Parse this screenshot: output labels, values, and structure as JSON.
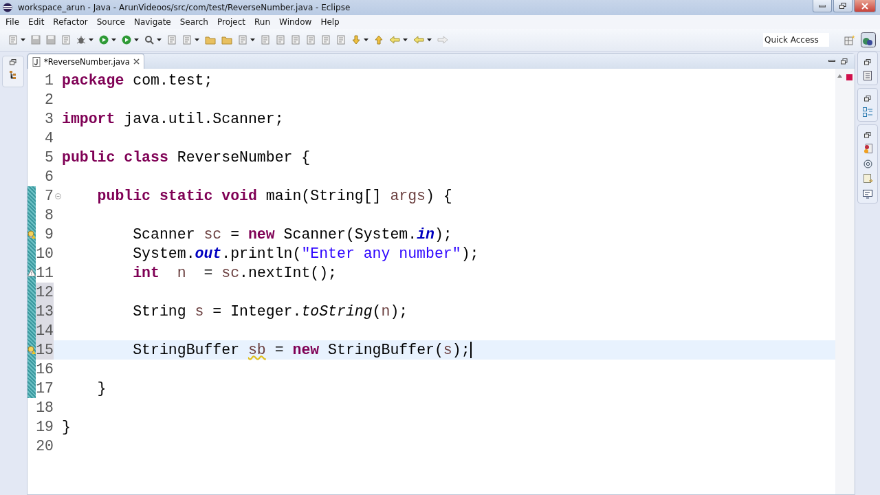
{
  "window": {
    "title": "workspace_arun - Java - ArunVideoos/src/com/test/ReverseNumber.java - Eclipse"
  },
  "menu": [
    "File",
    "Edit",
    "Refactor",
    "Source",
    "Navigate",
    "Search",
    "Project",
    "Run",
    "Window",
    "Help"
  ],
  "quick_access": {
    "placeholder": "Quick Access"
  },
  "editor_tab": {
    "label": "*ReverseNumber.java",
    "selected": true
  },
  "lines": [
    {
      "number": "1",
      "changed": false,
      "range": false,
      "current": false,
      "foldable": false,
      "quick_fix": false,
      "warning": false,
      "tokens": [
        {
          "text": "package",
          "kind": "keyword"
        },
        {
          "text": " com.test;",
          "kind": "plain"
        }
      ]
    },
    {
      "number": "2",
      "changed": false,
      "range": false,
      "current": false,
      "foldable": false,
      "quick_fix": false,
      "warning": false
    },
    {
      "number": "3",
      "changed": false,
      "range": false,
      "current": false,
      "foldable": false,
      "quick_fix": false,
      "warning": false,
      "tokens": [
        {
          "text": "import",
          "kind": "keyword"
        },
        {
          "text": " java.util.Scanner;",
          "kind": "plain"
        }
      ]
    },
    {
      "number": "4",
      "changed": false,
      "range": false,
      "current": false,
      "foldable": false,
      "quick_fix": false,
      "warning": false
    },
    {
      "number": "5",
      "changed": false,
      "range": false,
      "current": false,
      "foldable": false,
      "quick_fix": false,
      "warning": false,
      "tokens": [
        {
          "text": "public class",
          "kind": "keyword"
        },
        {
          "text": " ReverseNumber {",
          "kind": "plain"
        }
      ]
    },
    {
      "number": "6",
      "changed": false,
      "range": false,
      "current": false,
      "foldable": false,
      "quick_fix": false,
      "warning": false
    },
    {
      "number": "7",
      "changed": true,
      "range": false,
      "current": false,
      "foldable": true,
      "quick_fix": false,
      "warning": false,
      "tokens": [
        {
          "text": "    public static void",
          "kind": "keyword"
        },
        {
          "text": " main(String[] ",
          "kind": "plain"
        },
        {
          "text": "args",
          "kind": "variable"
        },
        {
          "text": ") {",
          "kind": "plain"
        }
      ]
    },
    {
      "number": "8",
      "changed": true,
      "range": false,
      "current": false,
      "foldable": false,
      "quick_fix": false,
      "warning": false
    },
    {
      "number": "9",
      "changed": true,
      "range": false,
      "current": false,
      "foldable": false,
      "quick_fix": true,
      "warning": false,
      "tokens": [
        {
          "text": "        Scanner ",
          "kind": "plain"
        },
        {
          "text": "sc",
          "kind": "variable"
        },
        {
          "text": " = ",
          "kind": "plain"
        },
        {
          "text": "new",
          "kind": "keyword"
        },
        {
          "text": " Scanner(System.",
          "kind": "plain"
        },
        {
          "text": "in",
          "kind": "static"
        },
        {
          "text": ");",
          "kind": "plain"
        }
      ]
    },
    {
      "number": "10",
      "changed": true,
      "range": false,
      "current": false,
      "foldable": false,
      "quick_fix": false,
      "warning": false,
      "tokens": [
        {
          "text": "        System.",
          "kind": "plain"
        },
        {
          "text": "out",
          "kind": "static"
        },
        {
          "text": ".println(",
          "kind": "plain"
        },
        {
          "text": "\"Enter any number\"",
          "kind": "string"
        },
        {
          "text": ");",
          "kind": "plain"
        }
      ]
    },
    {
      "number": "11",
      "changed": true,
      "range": false,
      "current": false,
      "foldable": false,
      "quick_fix": false,
      "warning": true,
      "tokens": [
        {
          "text": "        int",
          "kind": "keyword"
        },
        {
          "text": "  n",
          "kind": "variable"
        },
        {
          "text": "  = ",
          "kind": "plain"
        },
        {
          "text": "sc",
          "kind": "variable"
        },
        {
          "text": ".nextInt();",
          "kind": "plain"
        }
      ]
    },
    {
      "number": "12",
      "changed": true,
      "range": true,
      "current": false,
      "foldable": false,
      "quick_fix": false,
      "warning": false
    },
    {
      "number": "13",
      "changed": true,
      "range": true,
      "current": false,
      "foldable": false,
      "quick_fix": false,
      "warning": false,
      "tokens": [
        {
          "text": "        String ",
          "kind": "plain"
        },
        {
          "text": "s",
          "kind": "variable"
        },
        {
          "text": " = Integer.",
          "kind": "plain"
        },
        {
          "text": "toString",
          "kind": "italic"
        },
        {
          "text": "(",
          "kind": "plain"
        },
        {
          "text": "n",
          "kind": "variable"
        },
        {
          "text": ");",
          "kind": "plain"
        }
      ]
    },
    {
      "number": "14",
      "changed": true,
      "range": true,
      "current": false,
      "foldable": false,
      "quick_fix": false,
      "warning": false
    },
    {
      "number": "15",
      "changed": true,
      "range": true,
      "current": true,
      "foldable": false,
      "quick_fix": true,
      "warning": false,
      "tokens": [
        {
          "text": "        StringBuffer ",
          "kind": "plain"
        },
        {
          "text": "sb",
          "kind": "warned"
        },
        {
          "text": " = ",
          "kind": "plain"
        },
        {
          "text": "new",
          "kind": "keyword"
        },
        {
          "text": " StringBuffer(",
          "kind": "plain"
        },
        {
          "text": "s",
          "kind": "variable"
        },
        {
          "text": ");",
          "kind": "plain"
        }
      ]
    },
    {
      "number": "16",
      "changed": true,
      "range": false,
      "current": false,
      "foldable": false,
      "quick_fix": false,
      "warning": false
    },
    {
      "number": "17",
      "changed": true,
      "range": false,
      "current": false,
      "foldable": false,
      "quick_fix": false,
      "warning": false,
      "tokens": [
        {
          "text": "    }",
          "kind": "plain"
        }
      ]
    },
    {
      "number": "18",
      "changed": false,
      "range": false,
      "current": false,
      "foldable": false,
      "quick_fix": false,
      "warning": false
    },
    {
      "number": "19",
      "changed": false,
      "range": false,
      "current": false,
      "foldable": false,
      "quick_fix": false,
      "warning": false,
      "tokens": [
        {
          "text": "}",
          "kind": "plain"
        }
      ]
    },
    {
      "number": "20",
      "changed": false,
      "range": false,
      "current": false,
      "foldable": false,
      "quick_fix": false,
      "warning": false
    }
  ]
}
